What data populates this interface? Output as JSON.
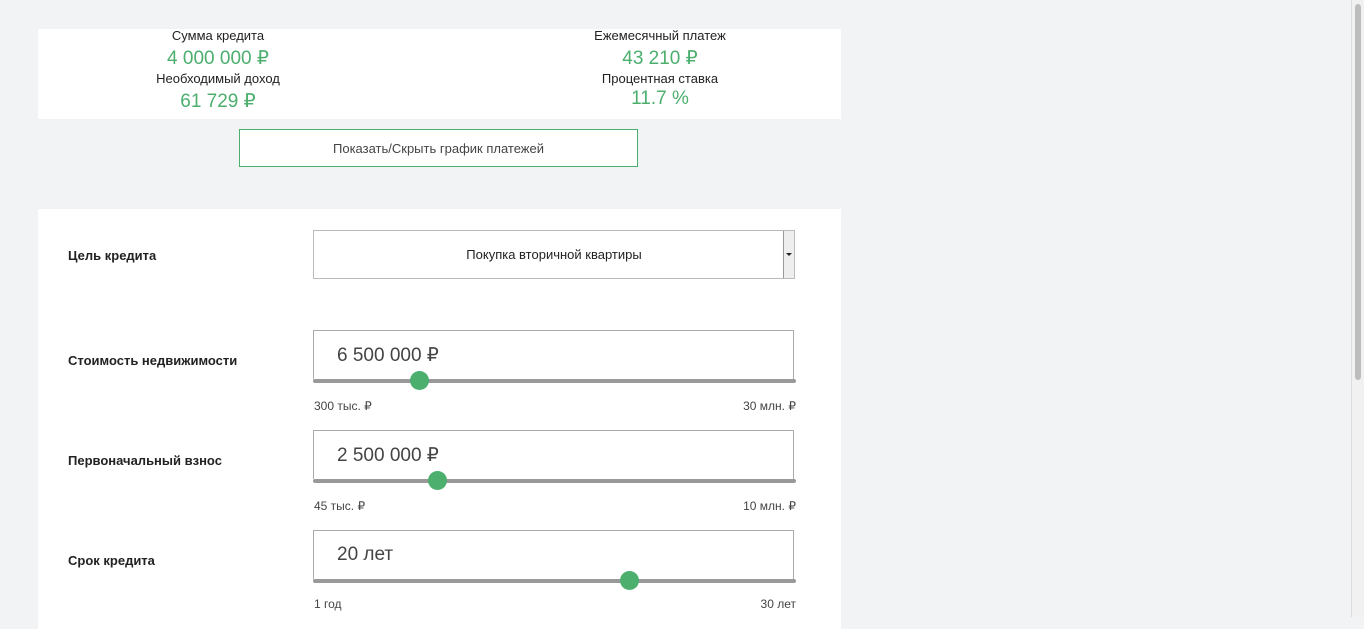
{
  "summary": {
    "loan_amount_label": "Сумма кредита",
    "loan_amount_value": "4 000 000 ₽",
    "income_label": "Необходимый доход",
    "income_value": "61 729 ₽",
    "monthly_payment_label": "Ежемесячный платеж",
    "monthly_payment_value": "43 210 ₽",
    "rate_label": "Процентная ставка",
    "rate_value": "11.7 %"
  },
  "toggle_schedule_label": "Показать/Скрыть график платежей",
  "form": {
    "purpose": {
      "label": "Цель кредита",
      "selected": "Покупка вторичной квартиры"
    },
    "property_cost": {
      "label": "Стоимость недвижимости",
      "value": "6 500 000 ₽",
      "min_label": "300 тыс. ₽",
      "max_label": "30 млн. ₽",
      "slider_fraction": 0.2188
    },
    "down_payment": {
      "label": "Первоначальный взнос",
      "value": "2 500 000 ₽",
      "min_label": "45 тыс. ₽",
      "max_label": "10 млн. ₽",
      "slider_fraction": 0.2562
    },
    "term": {
      "label": "Срок кредита",
      "value": "20 лет",
      "min_label": "1 год",
      "max_label": "30 лет",
      "slider_fraction": 0.6542
    }
  },
  "colors": {
    "accent": "#4caf6e",
    "background": "#f2f3f5"
  },
  "icons": {
    "select_arrow": "chevron-down-icon"
  }
}
